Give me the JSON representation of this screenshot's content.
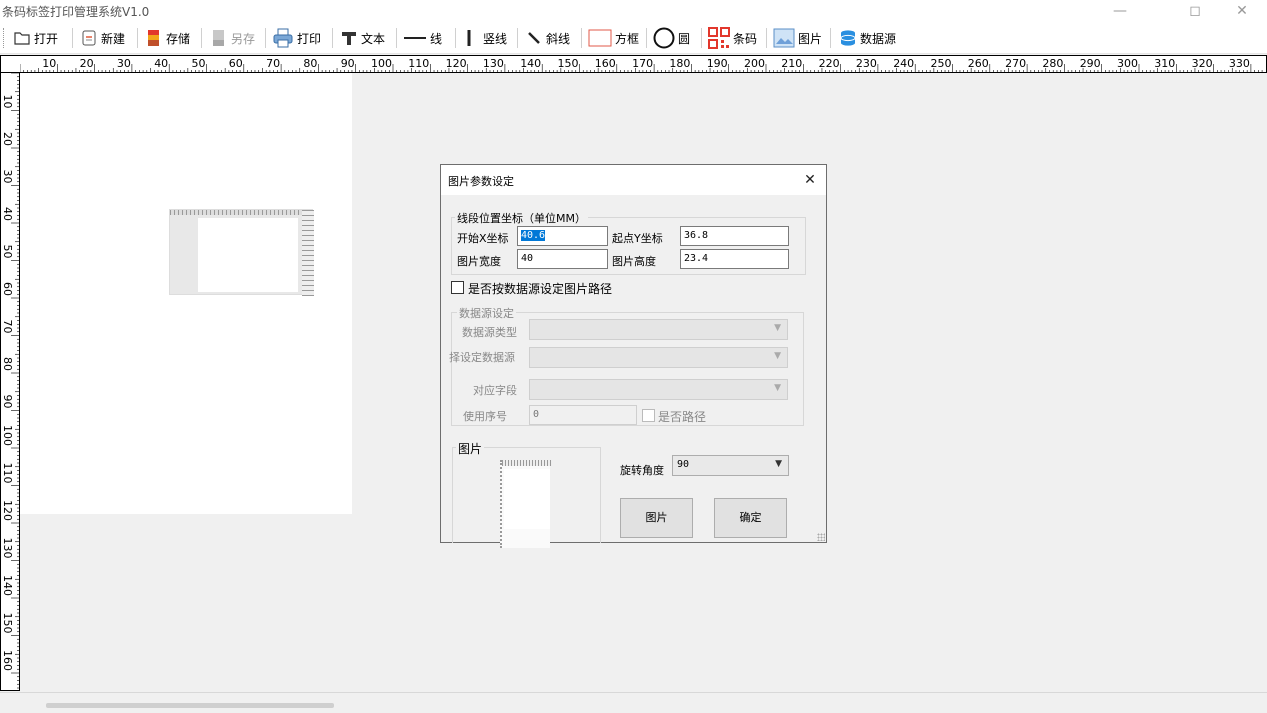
{
  "window": {
    "title": "条码标签打印管理系统V1.0",
    "minimize_glyph": "—",
    "maximize_glyph": "◻",
    "close_glyph": "✕"
  },
  "toolbar": {
    "open": "打开",
    "new": "新建",
    "save": "存储",
    "save_as": "另存",
    "print": "打印",
    "text": "文本",
    "line": "线",
    "vline": "竖线",
    "diag": "斜线",
    "rect": "方框",
    "circle": "圆",
    "barcode": "条码",
    "image": "图片",
    "datasource": "数据源"
  },
  "ruler": {
    "h_labels": [
      "10",
      "20",
      "30",
      "40",
      "50",
      "60",
      "70",
      "80",
      "90",
      "100",
      "110",
      "120",
      "130",
      "140",
      "150",
      "160",
      "170",
      "180",
      "190",
      "200",
      "210",
      "220",
      "230",
      "240",
      "250",
      "260",
      "270",
      "280",
      "290",
      "300",
      "310",
      "320",
      "330"
    ],
    "v_labels": [
      "10",
      "20",
      "30",
      "40",
      "50",
      "60",
      "70",
      "80",
      "90",
      "100",
      "110",
      "120",
      "130",
      "140",
      "150",
      "160"
    ]
  },
  "dialog": {
    "title": "图片参数设定",
    "close_glyph": "✕",
    "coord_group": "线段位置坐标（单位MM）",
    "start_x_label": "开始X坐标",
    "start_x_value": "40.6",
    "start_y_label": "起点Y坐标",
    "start_y_value": "36.8",
    "width_label": "图片宽度",
    "width_value": "40",
    "height_label": "图片高度",
    "height_value": "23.4",
    "use_datasource_label": "是否按数据源设定图片路径",
    "ds_group": "数据源设定",
    "ds_type_label": "数据源类型",
    "ds_select_label": "择设定数据源",
    "field_label": "对应字段",
    "index_label": "使用序号",
    "index_value": "0",
    "is_path_label": "是否路径",
    "image_group": "图片",
    "rotate_label": "旋转角度",
    "rotate_value": "90",
    "image_button": "图片",
    "ok_button": "确定"
  }
}
